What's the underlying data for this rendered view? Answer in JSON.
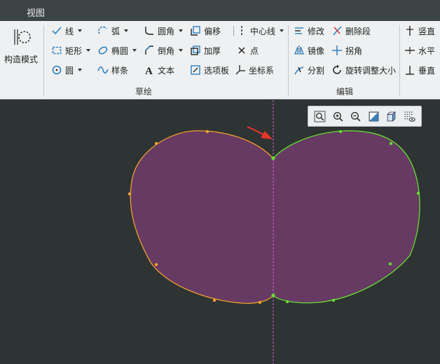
{
  "window": {
    "tab": "视图"
  },
  "ribbon": {
    "construct_mode": "构造模式",
    "sketch": {
      "group_label": "草绘",
      "line": "线",
      "arc": "弧",
      "fillet": "圆角",
      "offset": "偏移",
      "centerline": "中心线",
      "rectangle": "矩形",
      "ellipse": "椭圆",
      "chamfer": "倒角",
      "thicken": "加厚",
      "point": "点",
      "circle": "圆",
      "spline": "样条",
      "text": "文本",
      "palette": "选项板",
      "csys": "坐标系"
    },
    "edit": {
      "group_label": "编辑",
      "modify": "修改",
      "delete_segment": "删除段",
      "mirror": "镜像",
      "corner": "拐角",
      "divide": "分割",
      "rotate_resize": "旋转调整大小"
    },
    "constrain": {
      "vertical": "竖直",
      "horizontal": "水平",
      "perpendicular": "垂直"
    }
  },
  "colors": {
    "fill": "#663a63",
    "curve_left": "#f0a030",
    "curve_right": "#66dd33",
    "centerline": "#cc66cc",
    "arrow": "#e8352a"
  }
}
